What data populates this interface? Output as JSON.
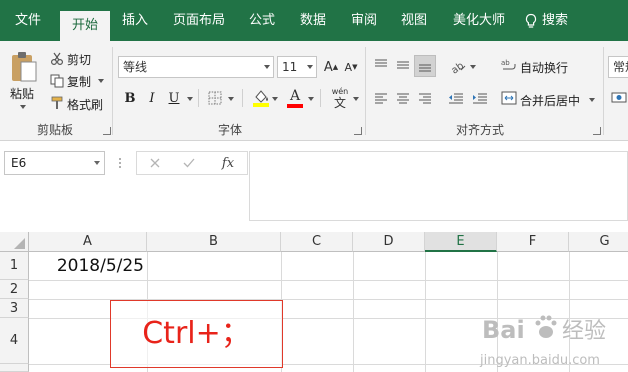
{
  "tabs": [
    {
      "label": "文件"
    },
    {
      "label": "开始",
      "active": true
    },
    {
      "label": "插入"
    },
    {
      "label": "页面布局"
    },
    {
      "label": "公式"
    },
    {
      "label": "数据"
    },
    {
      "label": "审阅"
    },
    {
      "label": "视图"
    },
    {
      "label": "美化大师"
    }
  ],
  "search": {
    "label": "搜索",
    "icon": "lightbulb-icon"
  },
  "clipboard": {
    "paste_label": "粘贴",
    "cut_label": "剪切",
    "copy_label": "复制",
    "format_painter_label": "格式刷",
    "group_label": "剪贴板"
  },
  "font": {
    "name": "等线",
    "size": "11",
    "bold": "B",
    "italic": "I",
    "underline": "U",
    "phonetic_top": "wén",
    "phonetic_char": "文",
    "fill_color": "#ffff00",
    "font_color": "#ff0000",
    "group_label": "字体"
  },
  "alignment": {
    "wrap_label": "自动换行",
    "merge_label": "合并后居中",
    "group_label": "对齐方式"
  },
  "number": {
    "format_label": "常规"
  },
  "formula_bar": {
    "name_box": "E6",
    "fx_label": "fx",
    "value": ""
  },
  "grid": {
    "columns": [
      "A",
      "B",
      "C",
      "D",
      "E",
      "F",
      "G"
    ],
    "selected_column": "E",
    "rows": [
      "1",
      "2",
      "3",
      "4"
    ],
    "cells": {
      "A1": "2018/5/25"
    }
  },
  "annotation": {
    "text": "Ctrl+；",
    "color": "#e8231a"
  },
  "watermark": {
    "brand": "Baidu",
    "sub1": "经验",
    "url": "jingyan.baidu.com"
  }
}
